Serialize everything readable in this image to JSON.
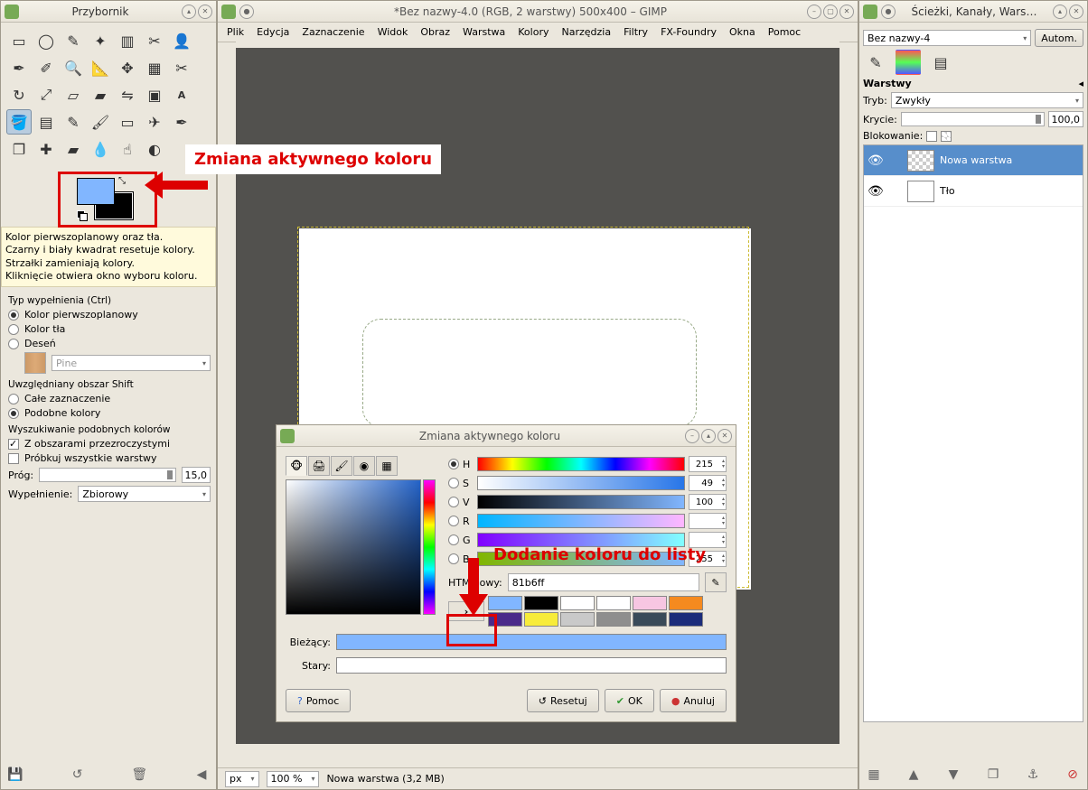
{
  "toolbox": {
    "title": "Przybornik",
    "color_help": [
      "Kolor pierwszoplanowy oraz tła.",
      "Czarny i biały kwadrat resetuje kolory.",
      "Strzałki zamieniają kolory.",
      "Kliknięcie otwiera okno wyboru koloru."
    ],
    "fill_type_label": "Typ wypełnienia  (Ctrl)",
    "fill_fg": "Kolor pierwszoplanowy",
    "fill_bg": "Kolor tła",
    "fill_pattern": "Deseń",
    "pattern_name": "Pine",
    "area_label": "Uwzględniany obszar  Shift",
    "area_whole": "Całe zaznaczenie",
    "area_similar": "Podobne kolory",
    "similar_section": "Wyszukiwanie podobnych kolorów",
    "alpha_opt": "Z obszarami przezroczystymi",
    "sample_opt": "Próbkuj wszystkie warstwy",
    "threshold_label": "Próg:",
    "threshold_val": "15,0",
    "fill_label": "Wypełnienie:",
    "fill_val": "Zbiorowy"
  },
  "canvas": {
    "title": "*Bez nazwy-4.0 (RGB, 2 warstwy) 500x400 – GIMP",
    "menus": [
      "Plik",
      "Edycja",
      "Zaznaczenie",
      "Widok",
      "Obraz",
      "Warstwa",
      "Kolory",
      "Narzędzia",
      "Filtry",
      "FX-Foundry",
      "Okna",
      "Pomoc"
    ],
    "status_unit": "px",
    "status_zoom": "100 %",
    "status_text": "Nowa warstwa (3,2 MB)"
  },
  "color_dialog": {
    "title": "Zmiana aktywnego koloru",
    "channels": {
      "H": "215",
      "S": "49",
      "V": "100",
      "R": "",
      "G": "",
      "B": "255"
    },
    "html_label": "HTML-owy:",
    "html_value": "81b6ff",
    "current_label": "Bieżący:",
    "old_label": "Stary:",
    "current_hex": "#81b6ff",
    "old_hex": "#ffffff",
    "swatches_top": [
      "#81b6ff",
      "#000000",
      "#ffffff",
      "#ffffff",
      "#f7c6e2",
      "#f58a1f"
    ],
    "swatches_bottom": [
      "#4a2a8a",
      "#f7ec3a",
      "#c9c9c9",
      "#8e8e8e",
      "#394a59",
      "#1b2c7a"
    ],
    "help": "Pomoc",
    "reset": "Resetuj",
    "ok": "OK",
    "cancel": "Anuluj"
  },
  "layers": {
    "title": "Ścieżki, Kanały, Wars…",
    "image_name": "Bez nazwy-4",
    "auto": "Autom.",
    "panel_label": "Warstwy",
    "mode_label": "Tryb:",
    "mode_val": "Zwykły",
    "opacity_label": "Krycie:",
    "opacity_val": "100,0",
    "lock_label": "Blokowanie:",
    "layer1": "Nowa warstwa",
    "layer2": "Tło"
  },
  "annotations": {
    "color_change": "Zmiana aktywnego koloru",
    "add_to_list": "Dodanie koloru do listy"
  }
}
